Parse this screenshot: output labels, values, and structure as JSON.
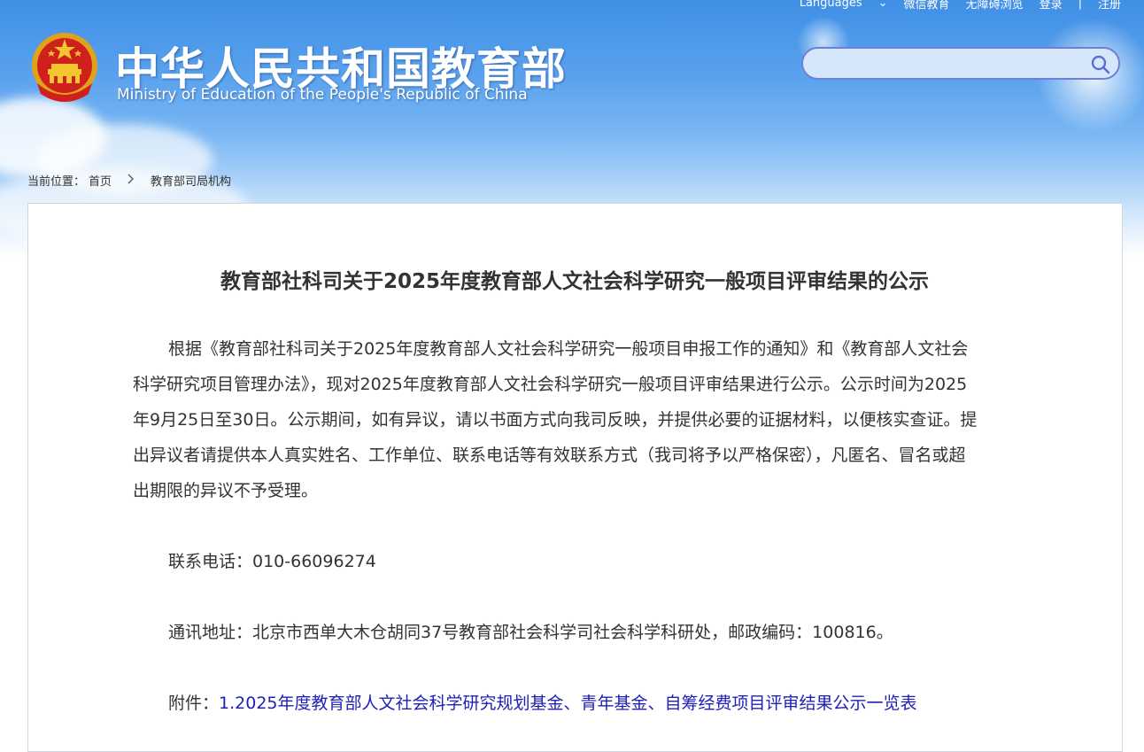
{
  "header": {
    "top_links": [
      "Languages",
      "⌄",
      "微信教育",
      "无障碍浏览",
      "登录",
      "|",
      "注册"
    ],
    "title_cn": "中华人民共和国教育部",
    "title_en": "Ministry of Education of the People's Republic of China",
    "search_placeholder": "",
    "colors": {
      "banner": "#3f8fe6",
      "search_border": "#6f7fd8",
      "link": "#1f1fb5"
    }
  },
  "breadcrumb": {
    "prefix": "当前位置：",
    "home": "首页",
    "separator": ">",
    "current": "教育部司局机构"
  },
  "article": {
    "title": "教育部社科司关于2025年度教育部人文社会科学研究一般项目评审结果的公示",
    "body_lines": [
      "根据《教育部社科司关于2025年度教育部人文社会科学研究一般项目申报工作的通知》和《教育部人文社会",
      "科学研究项目管理办法》，现对2025年度教育部人文社会科学研究一般项目评审结果进行公示。公示时间为2025",
      "年9月25日至30日。公示期间，如有异议，请以书面方式向我司反映，并提供必要的证据材料，以便核实查证。提",
      "出异议者请提供本人真实姓名、工作单位、联系电话等有效联系方式（我司将予以严格保密），凡匿名、冒名或超",
      "出期限的异议不予受理。"
    ],
    "phone": "联系电话：010-66096274",
    "address": "通讯地址：北京市西单大木仓胡同37号教育部社会科学司社会科学科研处，邮政编码：100816。",
    "attachment_label": "附件：",
    "attachment_link": "1.2025年度教育部人文社会科学研究规划基金、青年基金、自筹经费项目评审结果公示一览表"
  }
}
